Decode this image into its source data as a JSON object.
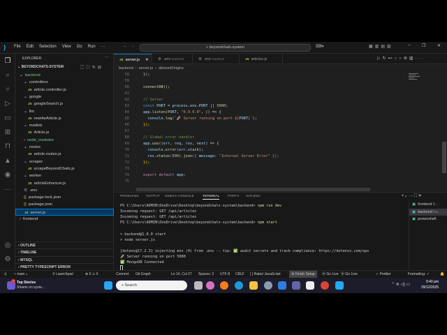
{
  "title_bar": {
    "menus": [
      "File",
      "Edit",
      "Selection",
      "View",
      "Go",
      "Run",
      "···"
    ],
    "search": "beyondchats-system"
  },
  "explorer": {
    "header": "EXPLORER",
    "root": "BEYONDCHATS-SYSTEM",
    "tree": [
      {
        "label": "backend",
        "type": "folder",
        "depth": 0,
        "open": true
      },
      {
        "label": "controllers",
        "type": "folder",
        "depth": 1,
        "open": true
      },
      {
        "label": "article.controller.js",
        "type": "js",
        "depth": 2
      },
      {
        "label": "google",
        "type": "folder",
        "depth": 1,
        "open": true
      },
      {
        "label": "googleSearch.js",
        "type": "js",
        "depth": 2
      },
      {
        "label": "llm",
        "type": "folder",
        "depth": 1,
        "open": true
      },
      {
        "label": "rewriteArticle.js",
        "type": "js",
        "depth": 2
      },
      {
        "label": "models",
        "type": "folder",
        "depth": 1,
        "open": true
      },
      {
        "label": "Article.js",
        "type": "js",
        "depth": 2
      },
      {
        "label": "node_modules",
        "type": "folder",
        "depth": 1,
        "open": false
      },
      {
        "label": "routes",
        "type": "folder",
        "depth": 1,
        "open": true
      },
      {
        "label": "article.routes.js",
        "type": "js",
        "depth": 2
      },
      {
        "label": "scraper",
        "type": "folder",
        "depth": 1,
        "open": true
      },
      {
        "label": "scrapeBeyondChats.js",
        "type": "js",
        "depth": 2
      },
      {
        "label": "worker",
        "type": "folder",
        "depth": 1,
        "open": true
      },
      {
        "label": "articleEnhancer.js",
        "type": "js",
        "depth": 2
      },
      {
        "label": ".env",
        "type": "env",
        "depth": 1
      },
      {
        "label": "package-lock.json",
        "type": "json",
        "depth": 1
      },
      {
        "label": "package.json",
        "type": "json",
        "depth": 1
      },
      {
        "label": "server.js",
        "type": "js",
        "depth": 1,
        "selected": true
      },
      {
        "label": "frontend",
        "type": "folder",
        "depth": 0,
        "open": false
      }
    ],
    "sections": [
      "OUTLINE",
      "TIMELINE",
      "MYSQL",
      "PRETTY TYPESCRIPT ERROR"
    ]
  },
  "tabs": [
    {
      "label": "server.js",
      "icon": "JS",
      "active": true
    },
    {
      "label": ".env",
      "sub": "backend",
      "icon": "⚙"
    },
    {
      "label": ".env",
      "sub": "frontend",
      "icon": "⚙"
    },
    {
      "label": "articles.js",
      "icon": "JS"
    }
  ],
  "breadcrumb": [
    "backend",
    "server.js",
    "allowedOrigins"
  ],
  "code": [
    {
      "no": "58",
      "t": [
        [
          "});",
          "p"
        ]
      ]
    },
    {
      "no": "59",
      "t": []
    },
    {
      "no": "60",
      "t": [
        [
          "connectDB",
          "f"
        ],
        [
          "();",
          "p"
        ]
      ]
    },
    {
      "no": "61",
      "t": []
    },
    {
      "no": "62",
      "t": [
        [
          "// Server",
          "c"
        ]
      ]
    },
    {
      "no": "63",
      "t": [
        [
          "const ",
          "b"
        ],
        [
          "PORT",
          "v"
        ],
        [
          " = ",
          "p"
        ],
        [
          "process",
          "v"
        ],
        [
          ".",
          "p"
        ],
        [
          "env",
          "v"
        ],
        [
          ".",
          "p"
        ],
        [
          "PORT",
          "v"
        ],
        [
          " || ",
          "p"
        ],
        [
          "5000",
          "n"
        ],
        [
          ";",
          "p"
        ]
      ]
    },
    {
      "no": "64",
      "t": [
        [
          "app",
          "v"
        ],
        [
          ".",
          "p"
        ],
        [
          "listen",
          "f"
        ],
        [
          "(",
          "y"
        ],
        [
          "PORT",
          "v"
        ],
        [
          ", ",
          "p"
        ],
        [
          "\"0.0.0.0\"",
          "s"
        ],
        [
          ", () => {",
          "p"
        ]
      ]
    },
    {
      "no": "65",
      "t": [
        [
          "  console",
          "v"
        ],
        [
          ".",
          "p"
        ],
        [
          "log",
          "f"
        ],
        [
          "(",
          "k"
        ],
        [
          "`🚀 Server running on port ${",
          "s"
        ],
        [
          "PORT",
          "v"
        ],
        [
          "}`",
          "s"
        ],
        [
          ");",
          "p"
        ]
      ]
    },
    {
      "no": "66",
      "t": [
        [
          "});",
          "y"
        ]
      ]
    },
    {
      "no": "67",
      "t": []
    },
    {
      "no": "68",
      "t": [
        [
          "// Global error handler",
          "c"
        ]
      ]
    },
    {
      "no": "69",
      "t": [
        [
          "app",
          "v"
        ],
        [
          ".",
          "p"
        ],
        [
          "use",
          "f"
        ],
        [
          "(",
          "y"
        ],
        [
          "(err, req, res, next)",
          "v"
        ],
        [
          " => {",
          "p"
        ]
      ]
    },
    {
      "no": "70",
      "t": [
        [
          "  console",
          "v"
        ],
        [
          ".",
          "p"
        ],
        [
          "error",
          "f"
        ],
        [
          "(",
          "k"
        ],
        [
          "err",
          "v"
        ],
        [
          ".",
          "p"
        ],
        [
          "stack",
          "v"
        ],
        [
          ");",
          "p"
        ]
      ]
    },
    {
      "no": "71",
      "t": [
        [
          "  res",
          "v"
        ],
        [
          ".",
          "p"
        ],
        [
          "status",
          "f"
        ],
        [
          "(",
          "k"
        ],
        [
          "500",
          "n"
        ],
        [
          ").",
          "p"
        ],
        [
          "json",
          "f"
        ],
        [
          "({ ",
          "k"
        ],
        [
          "message",
          "v"
        ],
        [
          ": ",
          "p"
        ],
        [
          "\"Internal Server Error\"",
          "s"
        ],
        [
          " });",
          "k"
        ]
      ]
    },
    {
      "no": "72",
      "t": [
        [
          "});",
          "y"
        ]
      ]
    },
    {
      "no": "73",
      "t": []
    },
    {
      "no": "74",
      "t": [
        [
          "export default ",
          "k"
        ],
        [
          "app",
          "v"
        ],
        [
          ";",
          "p"
        ]
      ]
    },
    {
      "no": "75",
      "t": []
    }
  ],
  "panel": {
    "tabs": [
      "PROBLEMS",
      "OUTPUT",
      "DEBUG CONSOLE",
      "TERMINAL",
      "PORTS",
      "GITLENS"
    ],
    "active_tab": "TERMINAL",
    "terminal": [
      {
        "prompt": "PS C:\\Users\\ADMIN\\OneDrive\\Desktop\\beyondchats-system\\backend> ",
        "cmd": "npm run dev"
      },
      {
        "text": "Incoming request: GET /api/articles"
      },
      {
        "text": "Incoming request: GET /api/articles"
      },
      {
        "prompt": "PS C:\\Users\\ADMIN\\OneDrive\\Desktop\\beyondchats-system\\backend> ",
        "cmd": "npm start"
      },
      {
        "text": ""
      },
      {
        "text": "> backend@1.0.0 start"
      },
      {
        "text": "> node server.js"
      },
      {
        "text": ""
      },
      {
        "text": "[dotenv@17.2.3] injecting env (4) from .env -- tip: ✅ audit secrets and track compliance: https://dotenvx.com/ops"
      },
      {
        "text": "🚀 Server running on port 5000"
      },
      {
        "text": "✅ MongoDB Connected"
      }
    ],
    "terminals": [
      {
        "label": "frontend",
        "sub": "fr..."
      },
      {
        "label": "backend",
        "sub": "ba...",
        "selected": true
      },
      {
        "label": "powershell"
      }
    ]
  },
  "status_bar": {
    "left": [
      "main",
      "Launchpad",
      "⊗ 0 ⚠ 0",
      "Connect",
      "Git Graph"
    ],
    "right": [
      "Ln 14, Col 27",
      "Spaces: 2",
      "UTF-8",
      "CRLF",
      "{ } Babel JavaScript",
      "Finish Setup",
      "Go Live",
      "Go Live",
      "✓ Prettier",
      "Formatting: ✓"
    ]
  },
  "taskbar": {
    "news_title": "Top Stories",
    "news_sub": "Shame on syste...",
    "news_badge": "7",
    "search": "Search",
    "time": "9:40 pm",
    "date": "29/12/2025"
  }
}
